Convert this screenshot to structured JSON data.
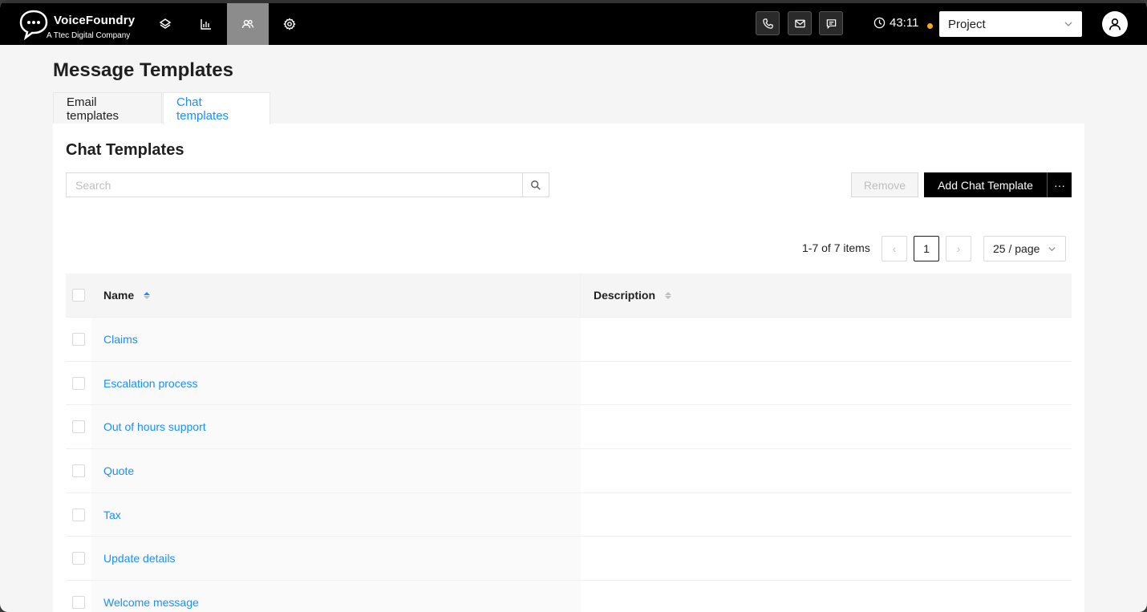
{
  "brand": {
    "title": "VoiceFoundry",
    "subtitle": "A Ttec Digital Company"
  },
  "nav": [
    {
      "name": "nav-layers",
      "icon": "layers-icon"
    },
    {
      "name": "nav-reports",
      "icon": "bar-chart-icon"
    },
    {
      "name": "nav-users",
      "icon": "users-icon",
      "active": true
    },
    {
      "name": "nav-settings",
      "icon": "gear-icon"
    }
  ],
  "channels": [
    {
      "name": "phone-channel-button",
      "icon": "phone-icon"
    },
    {
      "name": "email-channel-button",
      "icon": "mail-icon"
    },
    {
      "name": "chat-channel-button",
      "icon": "chat-icon"
    }
  ],
  "timer": {
    "value": "43:11",
    "status_color": "#f5a623"
  },
  "project_select": {
    "value": "Project"
  },
  "page": {
    "title": "Message Templates"
  },
  "tabs": [
    {
      "label": "Email templates",
      "active": false
    },
    {
      "label": "Chat templates",
      "active": true
    }
  ],
  "card": {
    "title": "Chat Templates",
    "search_placeholder": "Search",
    "remove_label": "Remove",
    "add_label": "Add Chat Template",
    "more_label": "···"
  },
  "pagination": {
    "total_text": "1-7 of 7 items",
    "current_page": "1",
    "prev": "‹",
    "next": "›",
    "page_size": "25 / page"
  },
  "table": {
    "columns": [
      "Name",
      "Description"
    ],
    "rows": [
      {
        "name": "Claims",
        "description": ""
      },
      {
        "name": "Escalation process",
        "description": ""
      },
      {
        "name": "Out of hours support",
        "description": ""
      },
      {
        "name": "Quote",
        "description": ""
      },
      {
        "name": "Tax",
        "description": ""
      },
      {
        "name": "Update details",
        "description": ""
      },
      {
        "name": "Welcome message",
        "description": ""
      }
    ]
  },
  "colors": {
    "accent": "#1890ff",
    "topbar": "#000000",
    "primary_button": "#000000"
  }
}
